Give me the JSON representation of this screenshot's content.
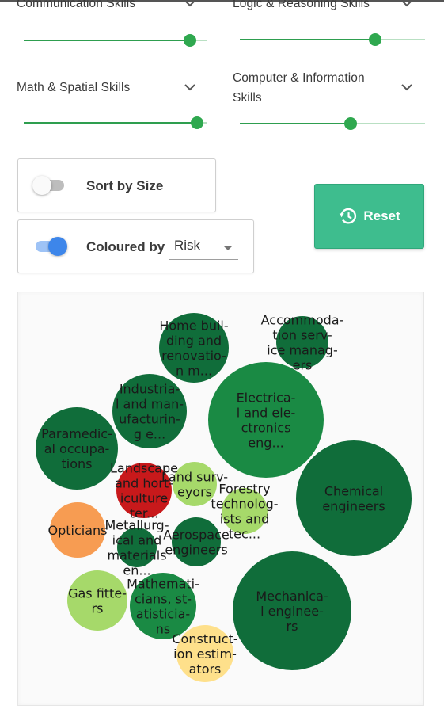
{
  "skills": [
    {
      "label": [
        "Communication Skills"
      ],
      "level": 0.91
    },
    {
      "label": [
        "Logic & Reasoning Skills"
      ],
      "level": 0.73
    },
    {
      "label": [
        "Math & Spatial Skills"
      ],
      "level": 0.95
    },
    {
      "label": [
        "Computer & Information",
        "Skills"
      ],
      "level": 0.6
    }
  ],
  "controls": {
    "sort_label": "Sort by Size",
    "sort_enabled": false,
    "colour_label": "Coloured by",
    "colour_value": "Risk",
    "colour_enabled": true,
    "reset_label": "Reset"
  },
  "colors": {
    "accent_green": "#2fa84f",
    "reset_button": "#3ebd8e",
    "toggle_on": "#3d86ea",
    "risk_very_low": "#106d3a",
    "risk_low": "#1a8a44",
    "risk_medium_low": "#a6d96a",
    "risk_medium": "#fee08b",
    "risk_medium_high": "#f79c52",
    "risk_high": "#c8191b"
  },
  "bubbles": [
    {
      "label": [
        "Home buil-",
        "ding and",
        "renovatio-",
        "n m..."
      ],
      "risk": "risk_very_low"
    },
    {
      "label": [
        "Accommoda-",
        "tion serv-",
        "ice manag-",
        "ers"
      ],
      "risk": "risk_very_low"
    },
    {
      "label": [
        "Industria-",
        "l and man-",
        "ufacturin-",
        "g e..."
      ],
      "risk": "risk_very_low"
    },
    {
      "label": [
        "Electrica-",
        "l and ele-",
        "ctronics",
        "eng..."
      ],
      "risk": "risk_low"
    },
    {
      "label": [
        "Paramedic-",
        "al occupa-",
        "tions"
      ],
      "risk": "risk_very_low"
    },
    {
      "label": [
        "Chemical",
        "engineers"
      ],
      "risk": "risk_very_low"
    },
    {
      "label": [
        "Landscape",
        "and hort-",
        "iculture",
        "ter..."
      ],
      "risk": "risk_high"
    },
    {
      "label": [
        "Land surv-",
        "eyors"
      ],
      "risk": "risk_medium_low"
    },
    {
      "label": [
        "Forestry",
        "technolog-",
        "ists and",
        "tec..."
      ],
      "risk": "risk_medium_low"
    },
    {
      "label": [
        "Opticians"
      ],
      "risk": "risk_medium_high"
    },
    {
      "label": [
        "Metallurg-",
        "ical and",
        "materials",
        "en..."
      ],
      "risk": "risk_very_low"
    },
    {
      "label": [
        "Aerospace",
        "engineers"
      ],
      "risk": "risk_very_low"
    },
    {
      "label": [
        "Gas fitte-",
        "rs"
      ],
      "risk": "risk_medium_low"
    },
    {
      "label": [
        "Mathemati-",
        "cians, st-",
        "atisticia-",
        "ns"
      ],
      "risk": "risk_low"
    },
    {
      "label": [
        "Mechanica-",
        "l enginee-",
        "rs"
      ],
      "risk": "risk_very_low"
    },
    {
      "label": [
        "Construct-",
        "ion estim-",
        "ators"
      ],
      "risk": "risk_medium"
    }
  ]
}
